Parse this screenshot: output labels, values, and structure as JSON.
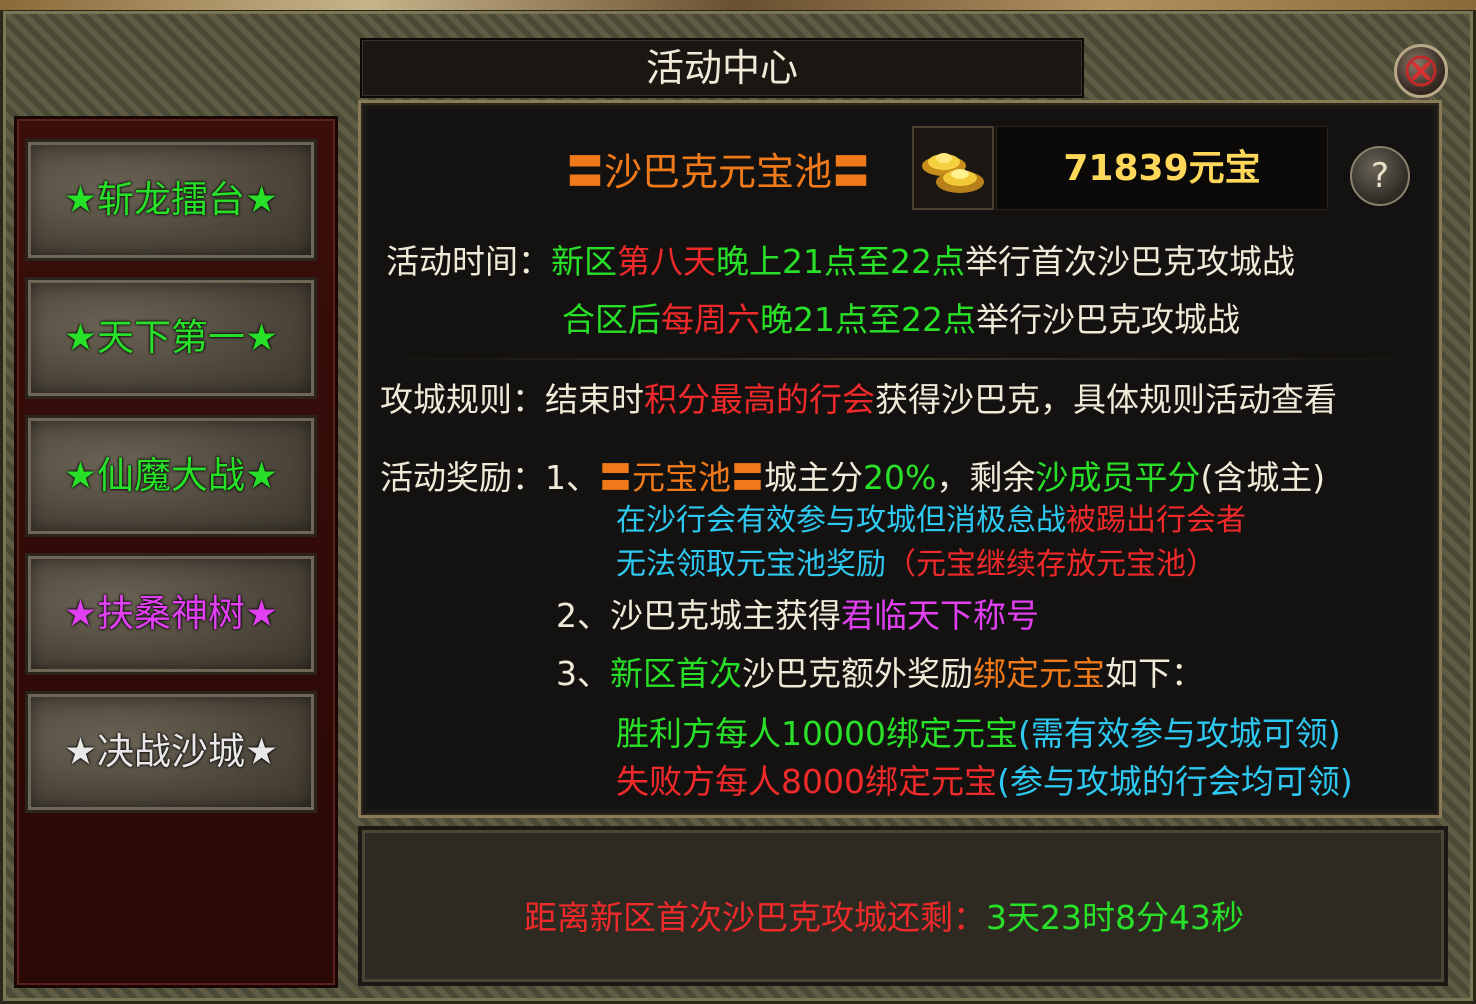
{
  "window": {
    "title": "活动中心"
  },
  "sidebar": {
    "items": [
      {
        "label": "★斩龙擂台★",
        "color": "#28e028"
      },
      {
        "label": "★天下第一★",
        "color": "#28e028"
      },
      {
        "label": "★仙魔大战★",
        "color": "#28e028"
      },
      {
        "label": "★扶桑神树★",
        "color": "#e040f0"
      },
      {
        "label": "★决战沙城★",
        "color": "#e8e8e8"
      }
    ]
  },
  "pool": {
    "title": "〓沙巴克元宝池〓",
    "amount": "71839元宝",
    "help": "?"
  },
  "schedule": {
    "label": "活动时间：",
    "line1": {
      "a": "新区",
      "b": "第八天",
      "c": "晚上21点至22点",
      "d": "举行首次沙巴克攻城战"
    },
    "line2": {
      "a": "合区后",
      "b": "每周六",
      "c": "晚21点至22点",
      "d": "举行沙巴克攻城战"
    }
  },
  "rules": {
    "label": "攻城规则：",
    "a": "结束时",
    "b": "积分最高的行会",
    "c": "获得沙巴克，具体规则活动查看"
  },
  "rewards": {
    "label": "活动奖励：",
    "r1": {
      "num": "1、",
      "a": "〓元宝池〓",
      "b": "城主分",
      "c": "20%",
      "d": "，剩余",
      "e": "沙成员平分",
      "f": "(含城主)"
    },
    "r1_note1": {
      "a": "在沙行会有效参与攻城但消极怠战",
      "b": "被踢出行会者"
    },
    "r1_note2": {
      "a": "无法领取元宝池奖励",
      "b": "（元宝继续存放元宝池）"
    },
    "r2": {
      "a": "2、沙巴克城主获得",
      "b": "君临天下称号"
    },
    "r3": {
      "num": "3、",
      "a": "新区首次",
      "b": "沙巴克额外奖励",
      "c": "绑定元宝",
      "d": "如下："
    },
    "r3_win": {
      "a": "胜利方每人10000绑定元宝",
      "b": "(需有效参与攻城可领)"
    },
    "r3_lose": {
      "a": "失败方每人8000绑定元宝",
      "b": "(参与攻城的行会均可领)"
    }
  },
  "countdown": {
    "label": "距离新区首次沙巴克攻城还剩：",
    "value": "3天23时8分43秒"
  }
}
